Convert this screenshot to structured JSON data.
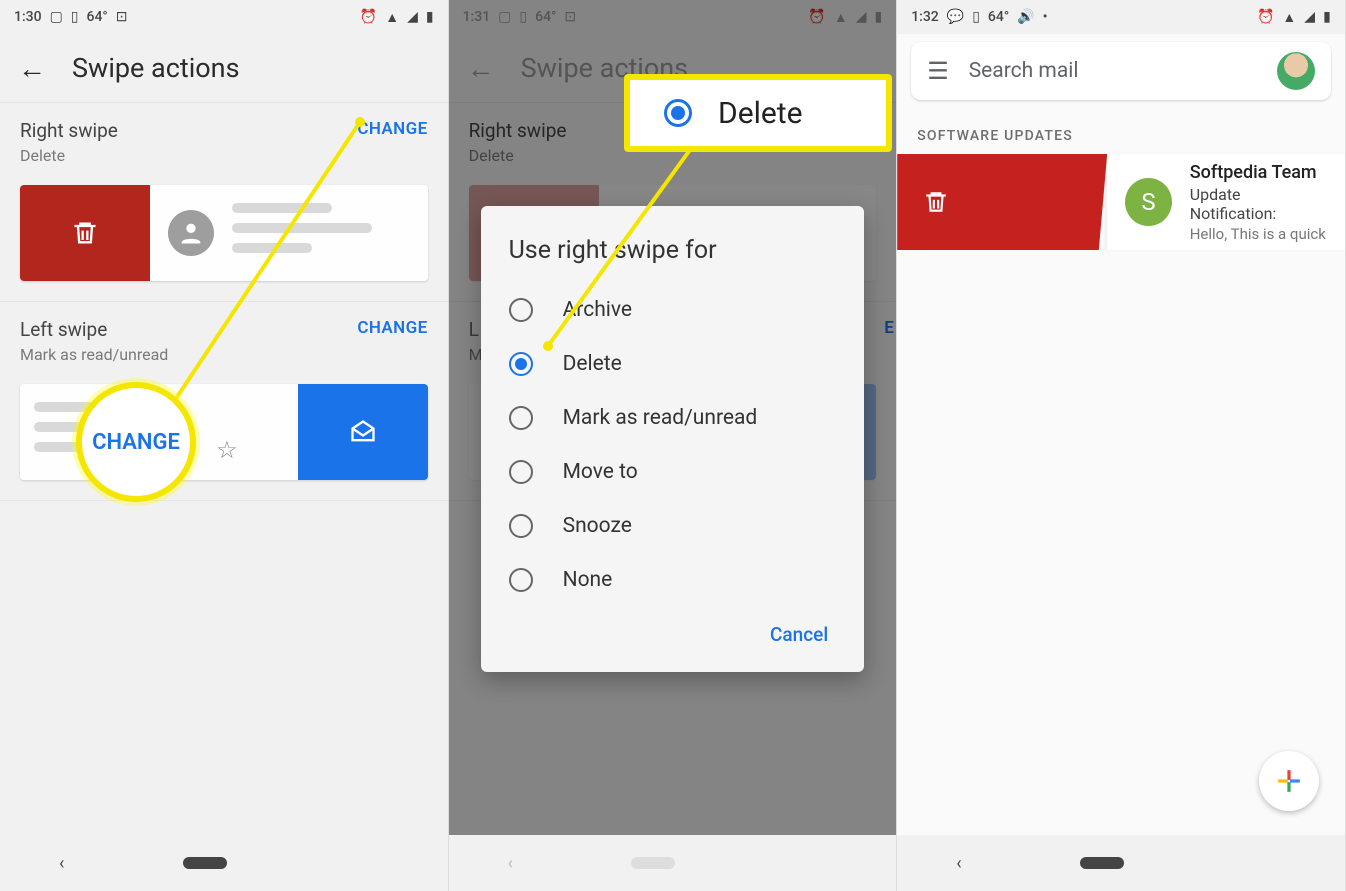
{
  "screen1": {
    "time": "1:30",
    "temp": "64°",
    "title": "Swipe actions",
    "right": {
      "label": "Right swipe",
      "sub": "Delete",
      "change": "CHANGE"
    },
    "left": {
      "label": "Left swipe",
      "sub": "Mark as read/unread",
      "change": "CHANGE"
    },
    "callout": "CHANGE"
  },
  "screen2": {
    "time": "1:31",
    "temp": "64°",
    "title": "Swipe actions",
    "dialog": {
      "title": "Use right swipe for",
      "options": {
        "o0": "Archive",
        "o1": "Delete",
        "o2": "Mark as read/unread",
        "o3": "Move to",
        "o4": "Snooze",
        "o5": "None"
      },
      "cancel": "Cancel"
    },
    "callout": "Delete",
    "left_change_peek": "E"
  },
  "screen3": {
    "time": "1:32",
    "search_placeholder": "Search mail",
    "section_label": "SOFTWARE UPDATES",
    "mail": {
      "avatar_letter": "S",
      "from": "Softpedia Team",
      "subject": "Update Notification:",
      "body": "Hello, This is a quick"
    }
  }
}
